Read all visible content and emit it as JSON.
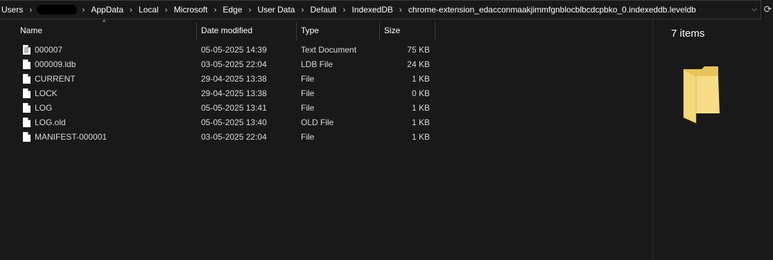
{
  "breadcrumb": [
    "Users",
    "AppData",
    "Local",
    "Microsoft",
    "Edge",
    "User Data",
    "Default",
    "IndexedDB",
    "chrome-extension_edacconmaakjimmfgnblocblbcdcpbko_0.indexeddb.leveldb"
  ],
  "columns": {
    "name": "Name",
    "date": "Date modified",
    "type": "Type",
    "size": "Size"
  },
  "files": [
    {
      "name": "000007",
      "date": "05-05-2025 14:39",
      "type": "Text Document",
      "size": "75 KB",
      "icon": "text-document-icon"
    },
    {
      "name": "000009.ldb",
      "date": "03-05-2025 22:04",
      "type": "LDB File",
      "size": "24 KB",
      "icon": "file-icon"
    },
    {
      "name": "CURRENT",
      "date": "29-04-2025 13:38",
      "type": "File",
      "size": "1 KB",
      "icon": "file-icon"
    },
    {
      "name": "LOCK",
      "date": "29-04-2025 13:38",
      "type": "File",
      "size": "0 KB",
      "icon": "file-icon"
    },
    {
      "name": "LOG",
      "date": "05-05-2025 13:41",
      "type": "File",
      "size": "1 KB",
      "icon": "file-icon"
    },
    {
      "name": "LOG.old",
      "date": "05-05-2025 13:40",
      "type": "OLD File",
      "size": "1 KB",
      "icon": "file-icon"
    },
    {
      "name": "MANIFEST-000001",
      "date": "03-05-2025 22:04",
      "type": "File",
      "size": "1 KB",
      "icon": "file-icon"
    }
  ],
  "details": {
    "item_count": "7 items",
    "icon": "folder-icon"
  },
  "colors": {
    "background": "#191919",
    "text": "#ffffff",
    "folder": "#f3d26c"
  }
}
